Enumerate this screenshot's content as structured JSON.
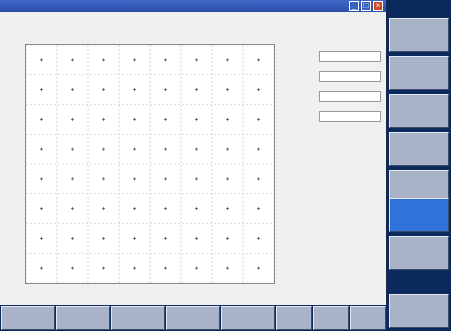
{
  "window": {
    "title": "",
    "buttons": {
      "minimize": "_",
      "maximize": "□",
      "close": "×"
    }
  },
  "status_line_1": "",
  "status_line_2": "",
  "plot": {
    "ref_mark": "",
    "x_ticks": [
      "",
      "",
      ""
    ],
    "y_ticks": [
      "",
      "",
      ""
    ]
  },
  "side_panel": {
    "values": [
      "",
      "",
      "",
      ""
    ]
  },
  "right_menu": {
    "title": "",
    "keys": [
      {
        "label": ""
      },
      {
        "label": ""
      },
      {
        "label": ""
      },
      {
        "label": ""
      },
      {
        "label": ""
      },
      {
        "label": "",
        "active": true
      },
      {
        "label": ""
      },
      {
        "label": ""
      }
    ]
  },
  "bottom_softkeys": [
    {
      "label": ""
    },
    {
      "label": ""
    },
    {
      "label": ""
    },
    {
      "label": ""
    },
    {
      "label": ""
    },
    {
      "label": ""
    },
    {
      "label": ""
    },
    {
      "label": ""
    }
  ],
  "chart_data": {
    "type": "scatter",
    "title": "",
    "xlabel": "",
    "ylabel": "",
    "xlim": [
      -8,
      8
    ],
    "ylim": [
      -8,
      8
    ],
    "grid": true,
    "x": [
      -7,
      -7,
      -7,
      -7,
      -7,
      -7,
      -7,
      -7,
      -5,
      -5,
      -5,
      -5,
      -5,
      -5,
      -5,
      -5,
      -3,
      -3,
      -3,
      -3,
      -3,
      -3,
      -3,
      -3,
      -1,
      -1,
      -1,
      -1,
      -1,
      -1,
      -1,
      -1,
      1,
      1,
      1,
      1,
      1,
      1,
      1,
      1,
      3,
      3,
      3,
      3,
      3,
      3,
      3,
      3,
      5,
      5,
      5,
      5,
      5,
      5,
      5,
      5,
      7,
      7,
      7,
      7,
      7,
      7,
      7,
      7
    ],
    "y": [
      -7,
      -5,
      -3,
      -1,
      1,
      3,
      5,
      7,
      -7,
      -5,
      -3,
      -1,
      1,
      3,
      5,
      7,
      -7,
      -5,
      -3,
      -1,
      1,
      3,
      5,
      7,
      -7,
      -5,
      -3,
      -1,
      1,
      3,
      5,
      7,
      -7,
      -5,
      -3,
      -1,
      1,
      3,
      5,
      7,
      -7,
      -5,
      -3,
      -1,
      1,
      3,
      5,
      7,
      -7,
      -5,
      -3,
      -1,
      1,
      3,
      5,
      7,
      -7,
      -5,
      -3,
      -1,
      1,
      3,
      5,
      7
    ],
    "colors": {
      "points": "#555555",
      "grid": "#bbbbbb"
    }
  }
}
